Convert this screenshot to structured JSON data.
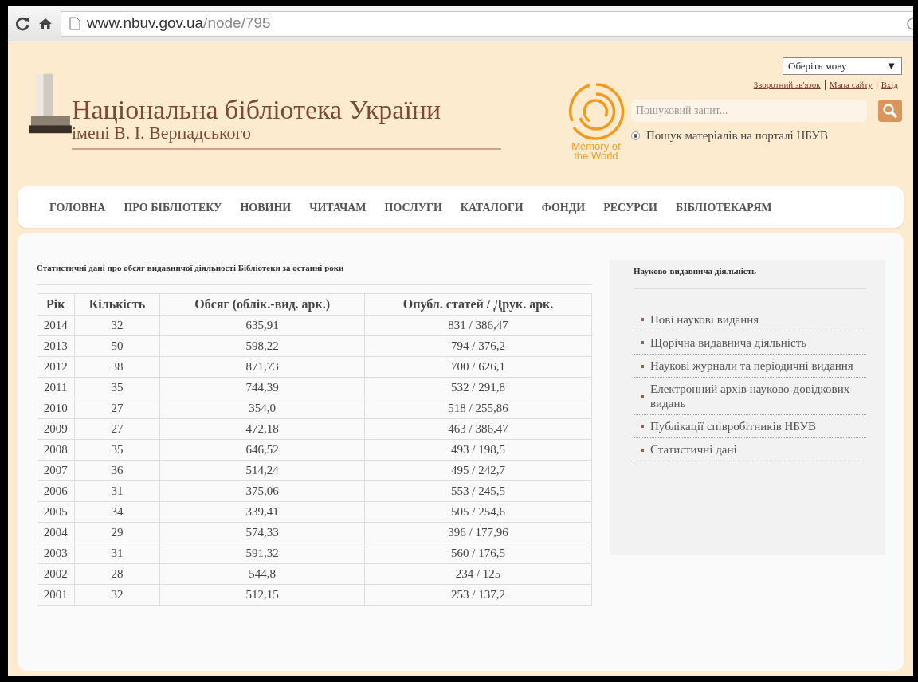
{
  "browser": {
    "url_host": "www.nbuv.gov.ua",
    "url_path": "/node/795"
  },
  "header": {
    "title": "Національна бібліотека України",
    "subtitle": "імені В. І. Вернадського",
    "memory_logo": "Memory of the World",
    "language_select": {
      "value": "Оберіть мову",
      "caret": "▼"
    },
    "top_links": [
      "Зворотний зв'язок",
      "Мапа сайту",
      "Вхід"
    ],
    "search": {
      "placeholder": "Пошуковий запит..."
    },
    "search_scope": {
      "label": "Пошук матеріалів на порталі НБУВ",
      "selected": true
    }
  },
  "nav": [
    "ГОЛОВНА",
    "ПРО БІБЛІОТЕКУ",
    "НОВИНИ",
    "ЧИТАЧАМ",
    "ПОСЛУГИ",
    "КАТАЛОГИ",
    "ФОНДИ",
    "РЕСУРСИ",
    "БІБЛІОТЕКАРЯМ"
  ],
  "table": {
    "caption": "Статистичні дані про обсяг видавничої діяльності Бібліотеки за останні роки",
    "columns": [
      "Рік",
      "Кількість",
      "Обсяг (облік.-вид. арк.)",
      "Опубл. статей / Друк. арк."
    ],
    "rows": [
      [
        "2014",
        "32",
        "635,91",
        "831 / 386,47"
      ],
      [
        "2013",
        "50",
        "598,22",
        "794 / 376,2"
      ],
      [
        "2012",
        "38",
        "871,73",
        "700 / 626,1"
      ],
      [
        "2011",
        "35",
        "744,39",
        "532 / 291,8"
      ],
      [
        "2010",
        "27",
        "354,0",
        "518 / 255,86"
      ],
      [
        "2009",
        "27",
        "472,18",
        "463 / 386,47"
      ],
      [
        "2008",
        "35",
        "646,52",
        "493 / 198,5"
      ],
      [
        "2007",
        "36",
        "514,24",
        "495 / 242,7"
      ],
      [
        "2006",
        "31",
        "375,06",
        "553 / 245,5"
      ],
      [
        "2005",
        "34",
        "339,41",
        "505 / 254,6"
      ],
      [
        "2004",
        "29",
        "574,33",
        "396 / 177,96"
      ],
      [
        "2003",
        "31",
        "591,32",
        "560 / 176,5"
      ],
      [
        "2002",
        "28",
        "544,8",
        "234 / 125"
      ],
      [
        "2001",
        "32",
        "512,15",
        "253 / 137,2"
      ]
    ]
  },
  "sidebar": {
    "title": "Науково-видавнича діяльність",
    "items": [
      "Нові наукові видання",
      "Щорічна видавнича діяльність",
      "Наукові журнали та періодичні видання",
      "Електронний архів науково-довідкових видань",
      "Публікації співробітників НБУВ",
      "Статистичні дані"
    ]
  }
}
